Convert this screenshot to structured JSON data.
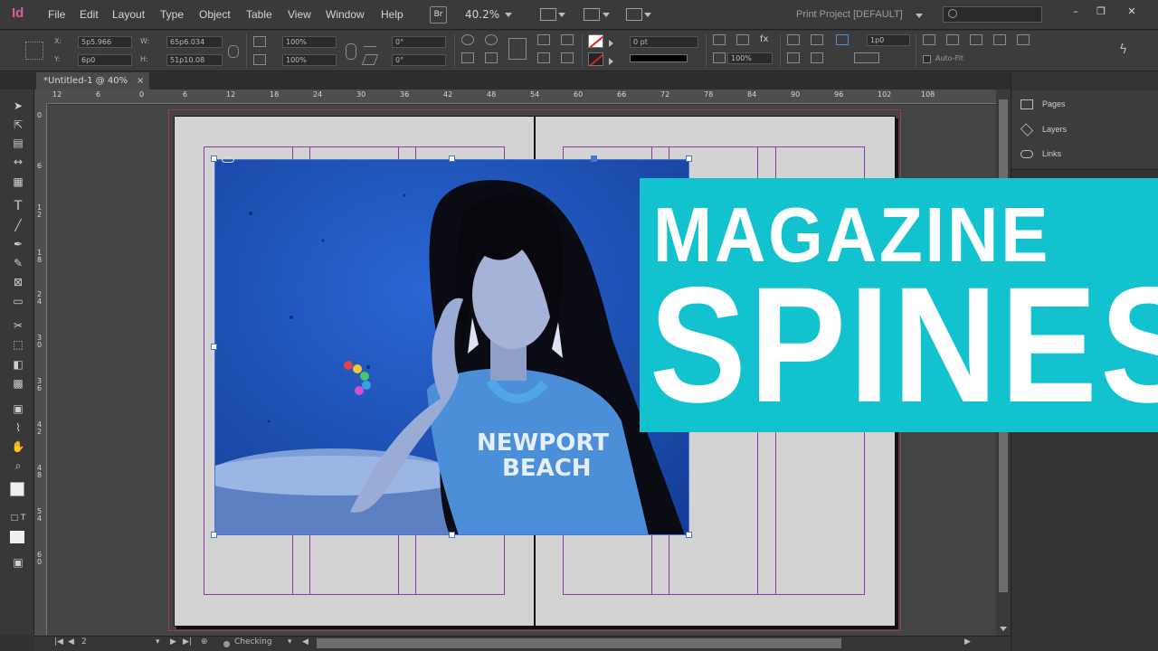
{
  "app": {
    "logo": "Id"
  },
  "menu": [
    "File",
    "Edit",
    "Layout",
    "Type",
    "Object",
    "Table",
    "View",
    "Window",
    "Help"
  ],
  "appbar": {
    "bridge_label": "Br",
    "zoom": "40.2%",
    "workspace": "Print Project [DEFAULT]",
    "search_placeholder": ""
  },
  "window_controls": {
    "minimize": "–",
    "restore": "❐",
    "close": "✕"
  },
  "control_panel": {
    "x_label": "X:",
    "x_value": "5p5.966",
    "y_label": "Y:",
    "y_value": "6p0",
    "w_label": "W:",
    "w_value": "65p6.034",
    "h_label": "H:",
    "h_value": "51p10.08",
    "scale_x": "100%",
    "scale_y": "100%",
    "rotate": "0°",
    "shear": "0°",
    "stroke_weight": "0 pt",
    "opacity": "100%",
    "frame_value": "1p0",
    "autofit_label": "Auto-Fit"
  },
  "document_tab": {
    "title": "*Untitled-1 @ 40%",
    "close": "×"
  },
  "ruler_top_ticks": [
    "12",
    "6",
    "0",
    "6",
    "12",
    "18",
    "24",
    "30",
    "36",
    "42",
    "48",
    "54",
    "60",
    "66",
    "72",
    "78",
    "84",
    "90",
    "96",
    "102",
    "108"
  ],
  "ruler_left_ticks": [
    "0",
    "6",
    "1 2",
    "1 8",
    "2 4",
    "3 0",
    "3 6",
    "4 2",
    "4 8",
    "5 4",
    "6 0"
  ],
  "statusbar": {
    "page": "2",
    "preflight": "Checking"
  },
  "panels": [
    {
      "label": "Pages",
      "icon": "pages-icon"
    },
    {
      "label": "Layers",
      "icon": "layers-icon"
    },
    {
      "label": "Links",
      "icon": "links-icon"
    }
  ],
  "banner": {
    "line1": "MAGAZINE",
    "line2": "SPINES"
  },
  "photo": {
    "shirt_text_1": "NEWPORT",
    "shirt_text_2": "BEACH"
  },
  "colors": {
    "accent": "#12c3cf",
    "guide": "#8a3aa6",
    "bleed": "#a2394d",
    "photo_bg": "#1d52b8",
    "logo": "#e05ca0"
  }
}
